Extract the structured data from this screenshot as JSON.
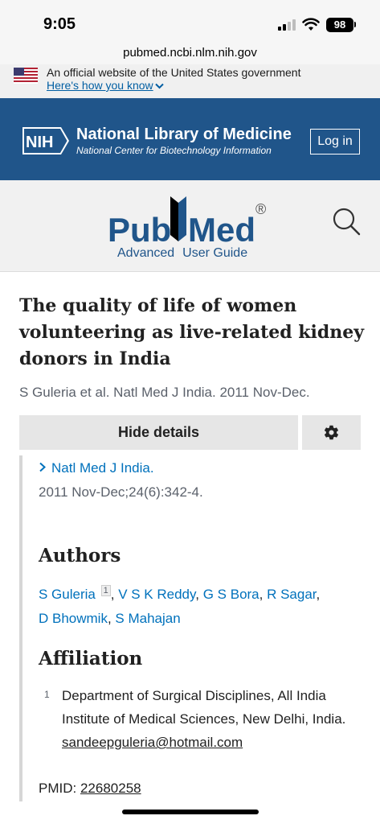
{
  "status": {
    "time": "9:05",
    "battery": "98"
  },
  "browser": {
    "url": "pubmed.ncbi.nlm.nih.gov"
  },
  "gov_banner": {
    "text": "An official website of the United States government",
    "link": "Here's how you know"
  },
  "nih_header": {
    "logo_text": "NIH",
    "title": "National Library of Medicine",
    "subtitle": "National Center for Biotechnology Information",
    "login": "Log in"
  },
  "pubmed": {
    "logo_left": "Pub",
    "logo_right": "Med",
    "registered": "®",
    "nav": [
      "Advanced",
      "User Guide"
    ]
  },
  "article": {
    "title": "The quality of life of women volunteering as live-related kidney donors in India",
    "cite": "S Guleria et al. Natl Med J India. 2011 Nov-Dec.",
    "hide_details": "Hide details",
    "journal": "Natl Med J India.",
    "journal_date": "2011 Nov-Dec;24(6):342-4.",
    "authors_heading": "Authors",
    "authors": [
      "S Guleria",
      "V S K Reddy",
      "G S Bora",
      "R Sagar",
      "D Bhowmik",
      "S Mahajan"
    ],
    "author_affiliation_marker": "1",
    "affiliation_heading": "Affiliation",
    "affiliation_number": "1",
    "affiliation_text": "Department of Surgical Disciplines, All India Institute of Medical Sciences, New Delhi, India.",
    "affiliation_email": "sandeepguleria@hotmail.com",
    "pmid_label": "PMID:",
    "pmid_value": "22680258"
  },
  "colors": {
    "nih_blue": "#20558a",
    "link_blue": "#0071bc",
    "gov_link": "#005ea2"
  },
  "icons": [
    "search-icon",
    "gear-icon",
    "chevron-down-icon",
    "chevron-right-icon",
    "us-flag-icon",
    "wifi-icon",
    "signal-icon",
    "battery-icon"
  ]
}
